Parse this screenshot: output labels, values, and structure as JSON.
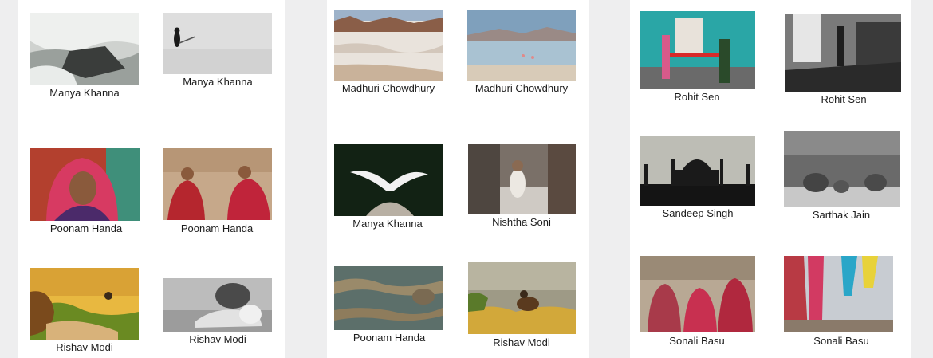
{
  "gallery": {
    "photos": [
      {
        "caption": "Manya Khanna",
        "subject": "waterfall"
      },
      {
        "caption": "Manya Khanna",
        "subject": "penguin"
      },
      {
        "caption": "Poonam Handa",
        "subject": "woman-portrait"
      },
      {
        "caption": "Poonam Handa",
        "subject": "two-women"
      },
      {
        "caption": "Rishav Modi",
        "subject": "lion-bird"
      },
      {
        "caption": "Rishav Modi",
        "subject": "lions-bw"
      },
      {
        "caption": "Madhuri Chowdhury",
        "subject": "salt-desert"
      },
      {
        "caption": "Madhuri Chowdhury",
        "subject": "lake-flamingos"
      },
      {
        "caption": "Manya Khanna",
        "subject": "white-bird"
      },
      {
        "caption": "Nishtha Soni",
        "subject": "old-man-doorway"
      },
      {
        "caption": "Poonam Handa",
        "subject": "heron-water"
      },
      {
        "caption": "Rishav Modi",
        "subject": "bird-grass"
      },
      {
        "caption": "Rohit Sen",
        "subject": "street-mural"
      },
      {
        "caption": "Rohit Sen",
        "subject": "room-bw"
      },
      {
        "caption": "Sandeep Singh",
        "subject": "taj-silhouette"
      },
      {
        "caption": "Sarthak Jain",
        "subject": "elephants-bw"
      },
      {
        "caption": "Sonali Basu",
        "subject": "women-group"
      },
      {
        "caption": "Sonali Basu",
        "subject": "sarees-ghat"
      }
    ]
  }
}
